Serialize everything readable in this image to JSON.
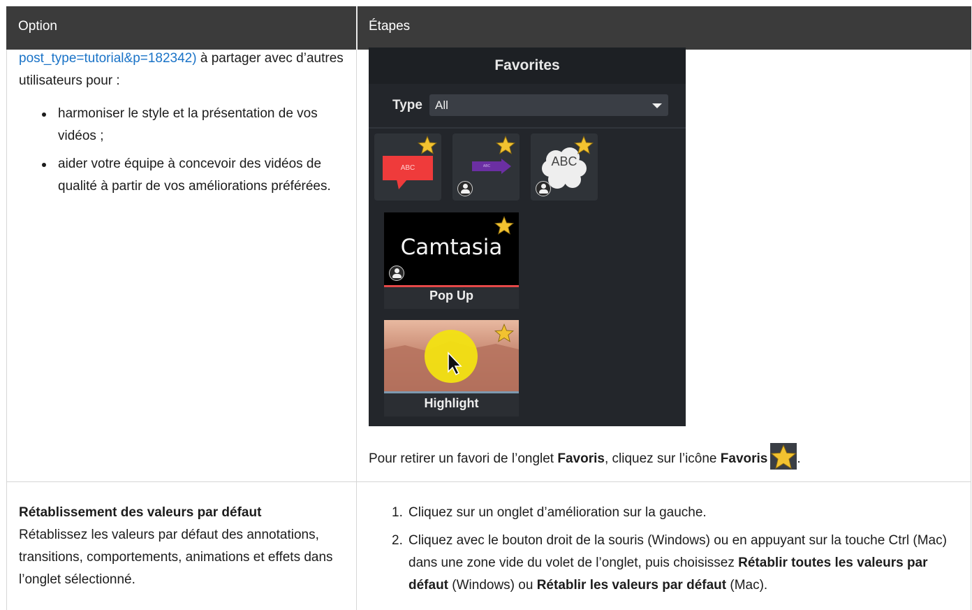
{
  "table": {
    "header": {
      "option": "Option",
      "steps": "Étapes"
    }
  },
  "row1": {
    "option": {
      "link_text": "post_type=tutorial&p=182342)",
      "text_after_link": " à partager avec d’autres utilisateurs pour :",
      "bullets": [
        "harmoniser le style et la présentation de vos vidéos ;",
        "aider votre équipe à concevoir des vidéos de qualité à partir de vos améliorations préférées."
      ]
    },
    "screenshot": {
      "panel_title": "Favorites",
      "type_label": "Type",
      "type_value": "All",
      "tiles": {
        "callout_text": "ABC",
        "arrow_text": "ABC",
        "cloud_text": "ABC"
      },
      "popup": {
        "preview_text": "Camtasia",
        "caption": "Pop Up"
      },
      "highlight": {
        "caption": "Highlight"
      },
      "star_color": "#f2c230"
    },
    "remove_note": {
      "before": "Pour retirer un favori de l’onglet ",
      "bold1": "Favoris",
      "middle": ", cliquez sur l’icône ",
      "bold2": "Favoris",
      "after": "."
    }
  },
  "row2": {
    "option": {
      "title": "Rétablissement des valeurs par défaut",
      "description": "Rétablissez les valeurs par défaut des annotations, transitions, comportements, animations et effets dans l’onglet sélectionné."
    },
    "steps": [
      {
        "num": "1.",
        "text": "Cliquez sur un onglet d’amélioration sur la gauche."
      },
      {
        "num": "2.",
        "text_a": "Cliquez avec le bouton droit de la souris (Windows) ou en appuyant sur la touche Ctrl (Mac) dans une zone vide du volet de l’onglet, puis choisissez ",
        "bold_a": "Rétablir toutes les valeurs par défaut",
        "text_b": " (Windows) ou ",
        "bold_b": "Rétablir les valeurs par défaut",
        "text_c": " (Mac)."
      }
    ]
  },
  "colors": {
    "header_bg": "#3b3b3b",
    "link": "#1a73c7",
    "panel_bg": "#23262b"
  }
}
